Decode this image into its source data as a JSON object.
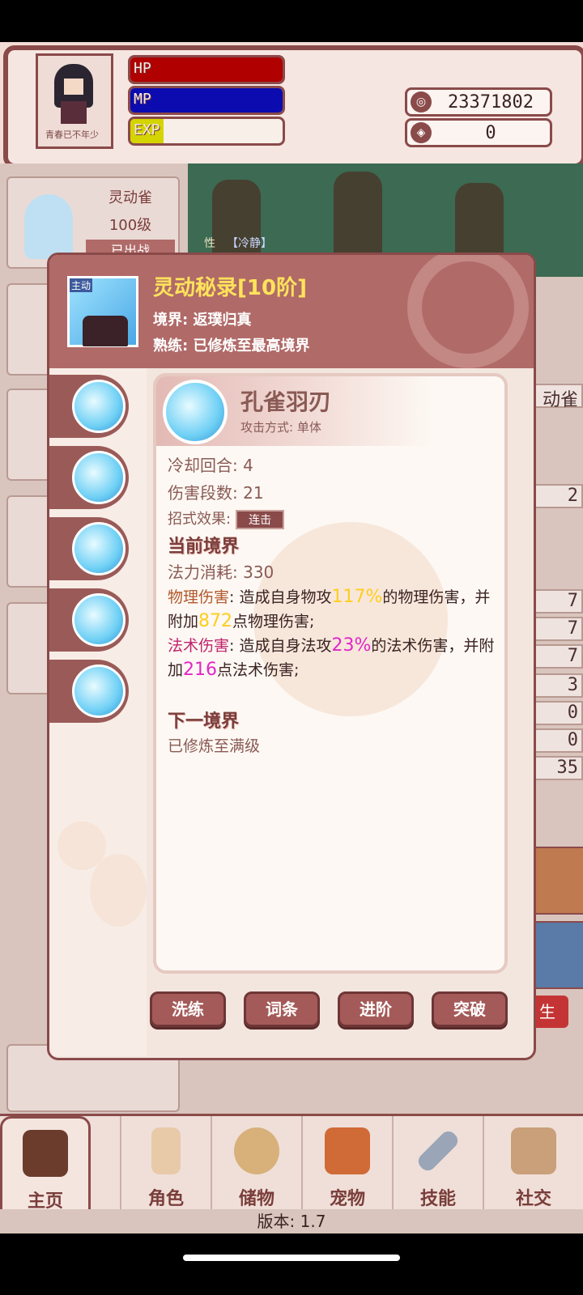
{
  "player": {
    "name": "青春已不年少",
    "bars": [
      {
        "label": "HP",
        "fill_pct": 100,
        "color": "#b00000"
      },
      {
        "label": "MP",
        "fill_pct": 100,
        "color": "#0b0bb0"
      },
      {
        "label": "EXP",
        "fill_pct": 22,
        "color": "#d4d400"
      }
    ],
    "currencies": [
      {
        "icon": "coin-icon",
        "value": "23371802"
      },
      {
        "icon": "gem-icon",
        "value": "0"
      }
    ]
  },
  "background": {
    "pet_card": {
      "name": "灵动雀",
      "level": "100级",
      "status": "已出战"
    },
    "trait_label": "性",
    "trait_value": "【冷静】",
    "right_label": "动雀",
    "right_values": [
      "2",
      "7",
      "7",
      "7",
      "3",
      "0",
      "0",
      "35"
    ],
    "right_button": "生"
  },
  "modal": {
    "badge": "主动",
    "title": "灵动秘录[10阶]",
    "realm_line": "境界: 返璞归真",
    "mastery_line": "熟练: 已修炼至最高境界",
    "skill": {
      "name": "孔雀羽刃",
      "attack_mode": "攻击方式: 单体",
      "cooldown_label": "冷却回合:",
      "cooldown_value": "4",
      "hits_label": "伤害段数:",
      "hits_value": "21",
      "effect_label": "招式效果:",
      "effect_tag": "连击",
      "current_realm_title": "当前境界",
      "mana_label": "法力消耗:",
      "mana_value": "330",
      "phys": {
        "key": "物理伤害",
        "t1": ": 造成自身物攻",
        "pct": "117%",
        "t2": "的物理伤害，并附加",
        "flat": "872",
        "t3": "点物理伤害;"
      },
      "mag": {
        "key": "法术伤害",
        "t1": ": 造成自身法攻",
        "pct": "23%",
        "t2": "的法术伤害，并附加",
        "flat": "216",
        "t3": "点法术伤害;"
      },
      "next_realm_title": "下一境界",
      "next_realm_text": "已修炼至满级"
    },
    "buttons": [
      "洗练",
      "词条",
      "进阶",
      "突破"
    ]
  },
  "nav": {
    "items": [
      "主页",
      "角色",
      "储物",
      "宠物",
      "技能",
      "社交"
    ],
    "version": "版本: 1.7"
  }
}
